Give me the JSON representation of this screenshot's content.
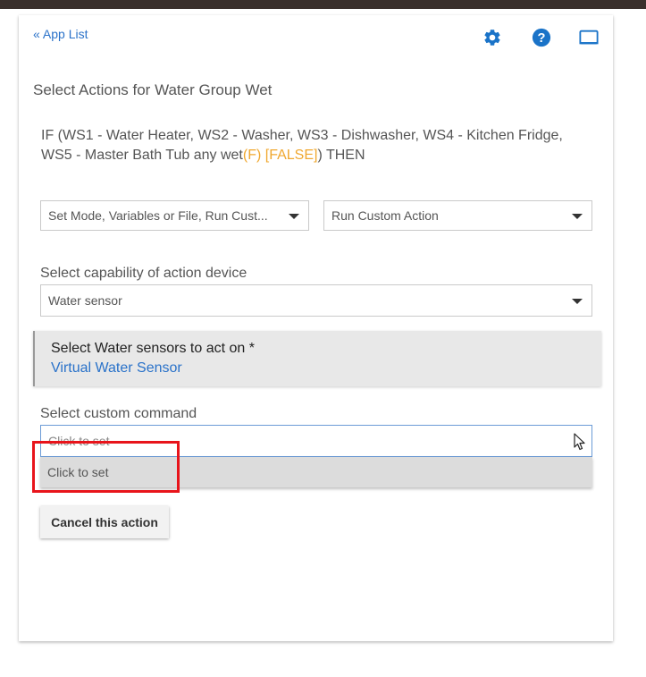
{
  "header": {
    "app_list_link": "« App List"
  },
  "icons": {
    "settings": "gear-icon",
    "help": "help-circle-icon",
    "display": "monitor-icon"
  },
  "page": {
    "title": "Select Actions for Water Group Wet"
  },
  "condition": {
    "text_part1": "IF (WS1 - Water Heater, WS2 - Washer, WS3 - Dishwasher, WS4 - Kitchen Fridge, WS5 - Master Bath Tub any wet",
    "flag": "(F) [FALSE]",
    "text_part2": ") THEN"
  },
  "action_type": {
    "selected": "Set Mode, Variables or File, Run Cust..."
  },
  "action": {
    "selected": "Run Custom Action"
  },
  "capability": {
    "label": "Select capability of action device",
    "selected": "Water sensor"
  },
  "devices": {
    "label": "Select Water sensors to act on *",
    "value": "Virtual Water Sensor"
  },
  "custom_command": {
    "label": "Select custom command",
    "placeholder": "Click to set",
    "option": "Click to set"
  },
  "buttons": {
    "cancel": "Cancel this action"
  },
  "colors": {
    "link_blue": "#2a72c9",
    "flag_orange": "#f0a830",
    "highlight_red": "#e8141b"
  }
}
